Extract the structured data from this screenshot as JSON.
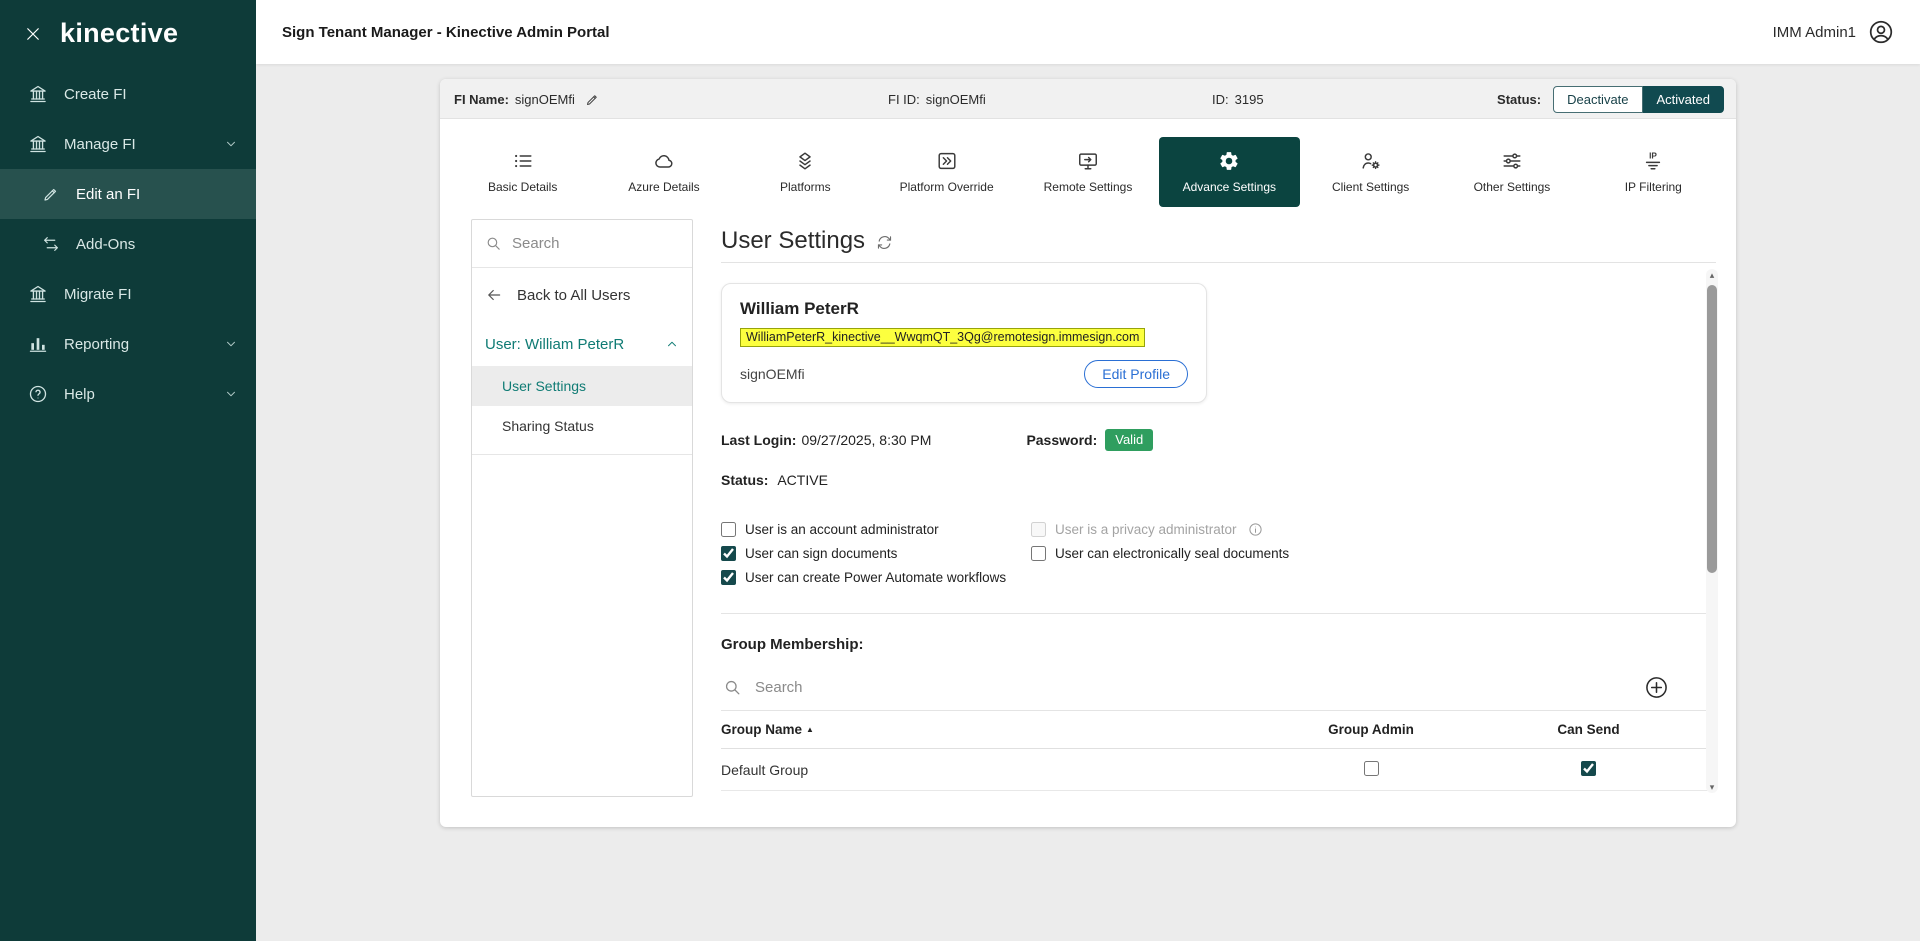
{
  "colors": {
    "sidebar_bg": "#0e3b39",
    "accent_teal": "#0f7b74",
    "active_tab_bg": "#0b4440",
    "activated_button_bg": "#114a50",
    "valid_badge_bg": "#2f9e5f",
    "email_highlight_bg": "#fcff3f",
    "email_highlight_border": "#96a30b",
    "edit_profile_blue": "#2a6fd4"
  },
  "icons": {
    "sort_asc": "▲"
  },
  "sidebar": {
    "logo_text": "kinective",
    "items": [
      {
        "label": "Create FI"
      },
      {
        "label": "Manage FI"
      },
      {
        "label": "Edit an FI"
      },
      {
        "label": "Add-Ons"
      },
      {
        "label": "Migrate FI"
      },
      {
        "label": "Reporting"
      },
      {
        "label": "Help"
      }
    ]
  },
  "topbar": {
    "title": "Sign Tenant Manager - Kinective Admin Portal",
    "user_name": "IMM Admin1"
  },
  "fi_header": {
    "fi_name_label": "FI Name:",
    "fi_name_value": "signOEMfi",
    "fi_id_label": "FI ID:",
    "fi_id_value": "signOEMfi",
    "id_label": "ID:",
    "id_value": "3195",
    "status_label": "Status:",
    "deactivate_button": "Deactivate",
    "activated_button": "Activated"
  },
  "tabs": [
    {
      "label": "Basic Details"
    },
    {
      "label": "Azure Details"
    },
    {
      "label": "Platforms"
    },
    {
      "label": "Platform Override"
    },
    {
      "label": "Remote Settings"
    },
    {
      "label": "Advance Settings"
    },
    {
      "label": "Client Settings"
    },
    {
      "label": "Other Settings"
    },
    {
      "label": "IP Filtering"
    }
  ],
  "user_nav": {
    "search_placeholder": "Search",
    "back_label": "Back to All Users",
    "user_label": "User: William PeterR",
    "items": [
      {
        "label": "User Settings"
      },
      {
        "label": "Sharing Status"
      }
    ]
  },
  "main": {
    "title": "User Settings",
    "profile": {
      "name": "William PeterR",
      "email": "WilliamPeterR_kinective__WwqmQT_3Qg@remotesign.immesign.com",
      "fi_name": "signOEMfi",
      "edit_button": "Edit Profile"
    },
    "last_login_label": "Last Login:",
    "last_login_value": "09/27/2025, 8:30 PM",
    "password_label": "Password:",
    "password_value": "Valid",
    "status_label": "Status:",
    "status_value": "ACTIVE",
    "permissions": [
      {
        "label": "User is an account administrator",
        "checked": false,
        "disabled": false
      },
      {
        "label": "User is a privacy administrator",
        "checked": false,
        "disabled": true
      },
      {
        "label": "User can sign documents",
        "checked": true,
        "disabled": false
      },
      {
        "label": "User can electronically seal documents",
        "checked": false,
        "disabled": false
      },
      {
        "label": "User can create Power Automate workflows",
        "checked": true,
        "disabled": false
      }
    ],
    "group_membership": {
      "title": "Group Membership:",
      "search_placeholder": "Search",
      "columns": [
        "Group Name",
        "Group Admin",
        "Can Send"
      ],
      "rows": [
        {
          "group_name": "Default Group",
          "group_admin": false,
          "can_send": true
        }
      ]
    }
  }
}
